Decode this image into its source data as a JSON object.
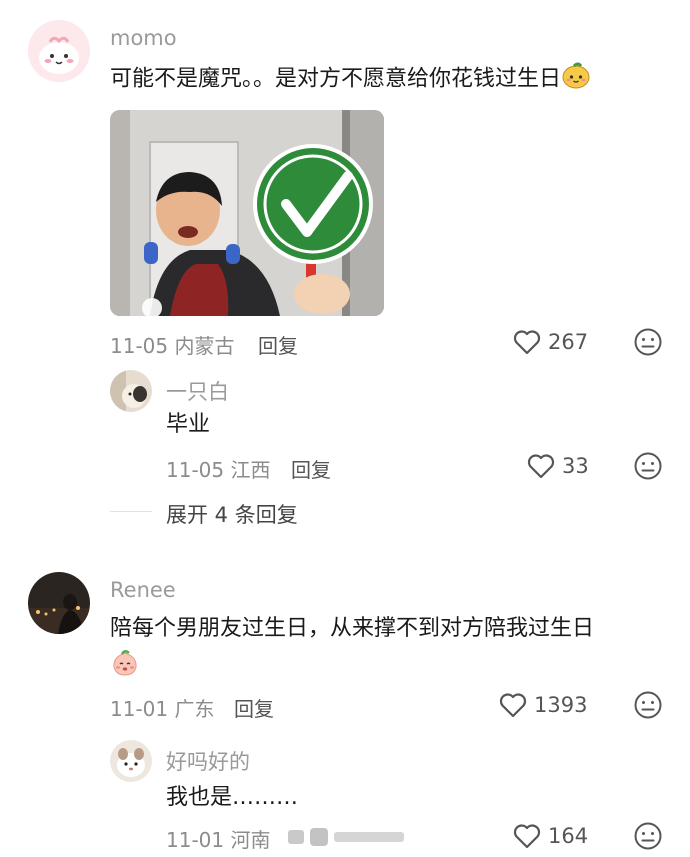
{
  "comments": [
    {
      "username": "momo",
      "text": "可能不是魔咒。。是对方不愿意给你花钱过生日",
      "date": "11-05",
      "location": "内蒙古",
      "reply_label": "回复",
      "likes": "267",
      "replies": [
        {
          "username": "一只白",
          "text": "毕业",
          "date": "11-05",
          "location": "江西",
          "reply_label": "回复",
          "likes": "33"
        }
      ],
      "expand_label": "展开 4 条回复"
    },
    {
      "username": "Renee",
      "text_line1": "陪每个男朋友过生日，从来撑不到对方陪我过生日",
      "date": "11-01",
      "location": "广东",
      "reply_label": "回复",
      "likes": "1393",
      "replies": [
        {
          "username": "好吗好的",
          "text": "我也是………",
          "date": "11-01",
          "location": "河南",
          "likes": "164"
        }
      ]
    }
  ],
  "icons": {
    "like": "heart-outline-icon",
    "dislike": "meh-face-icon",
    "emoji_1": "mango-emoji-icon",
    "emoji_2": "peach-emoji-icon"
  },
  "colors": {
    "accent_green": "#2e8b3a",
    "username_gray": "#9a9a9a"
  }
}
